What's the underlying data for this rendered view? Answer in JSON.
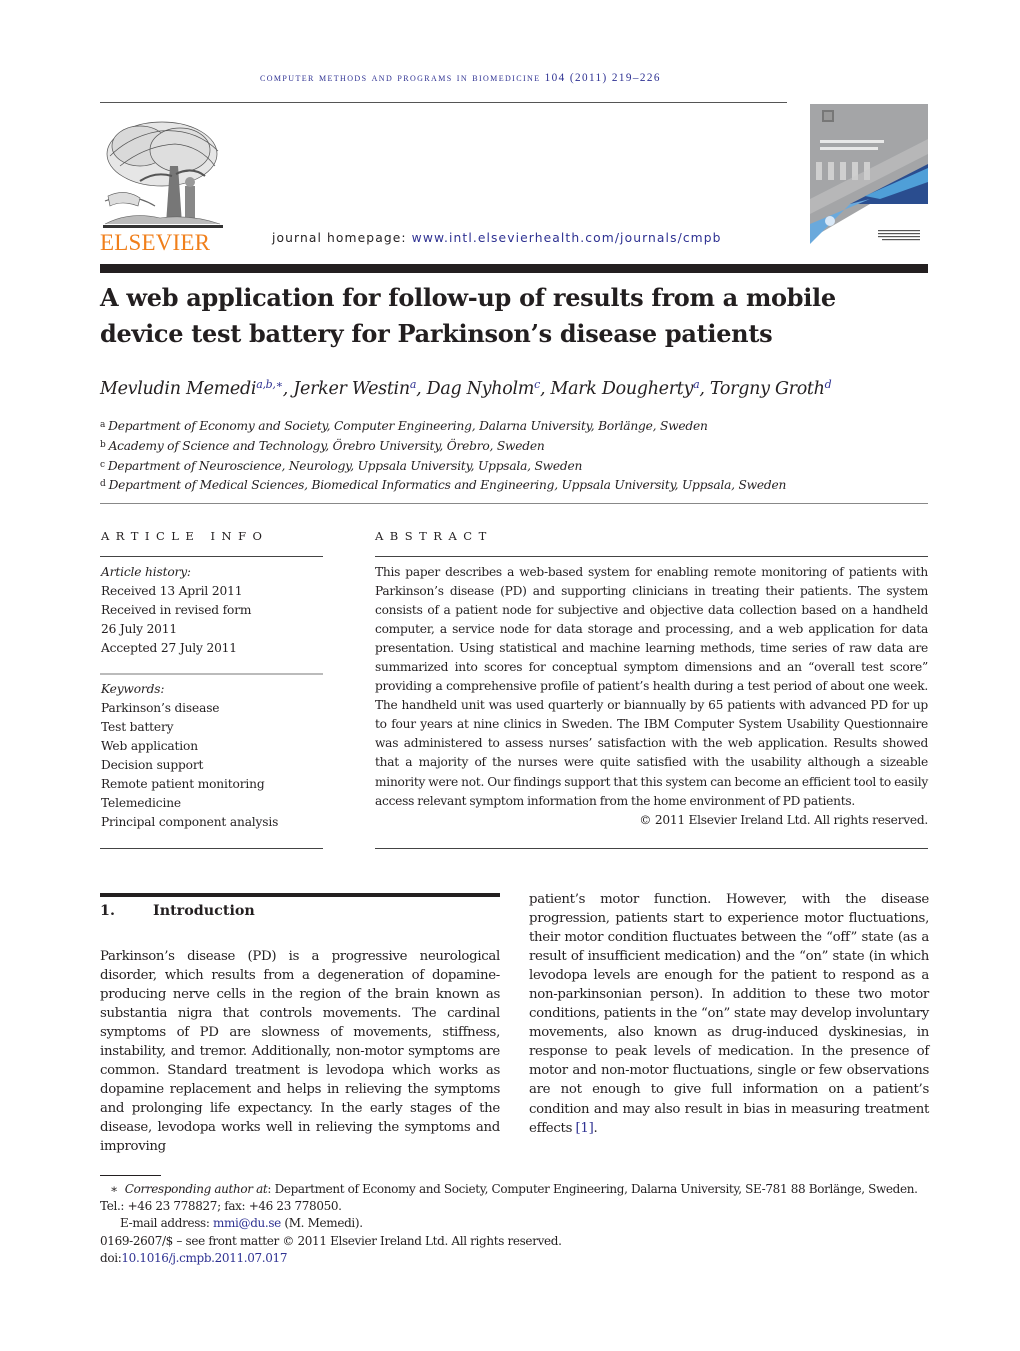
{
  "header": {
    "running_head": "computer methods and programs in biomedicine 104 (2011) 219–226",
    "publisher": "ELSEVIER",
    "homepage_label": "journal homepage: ",
    "homepage_url": "www.intl.elsevierhealth.com/journals/cmpb",
    "cover_title": "Computer Methods and Programs in Biomedicine"
  },
  "article": {
    "title": "A web application for follow-up of results from a mobile device test battery for Parkinson’s disease patients",
    "authors": [
      {
        "name": "Mevludin Memedi",
        "marks": "a,b,∗",
        "sep": ", "
      },
      {
        "name": "Jerker Westin",
        "marks": "a",
        "sep": ", "
      },
      {
        "name": "Dag Nyholm",
        "marks": "c",
        "sep": ", "
      },
      {
        "name": "Mark Dougherty",
        "marks": "a",
        "sep": ", "
      },
      {
        "name": "Torgny Groth",
        "marks": "d",
        "sep": ""
      }
    ],
    "affiliations": [
      {
        "mark": "a",
        "text": "Department of Economy and Society, Computer Engineering, Dalarna University, Borlänge, Sweden"
      },
      {
        "mark": "b",
        "text": "Academy of Science and Technology, Örebro University, Örebro, Sweden"
      },
      {
        "mark": "c",
        "text": "Department of Neuroscience, Neurology, Uppsala University, Uppsala, Sweden"
      },
      {
        "mark": "d",
        "text": "Department of Medical Sciences, Biomedical Informatics and Engineering, Uppsala University, Uppsala, Sweden"
      }
    ]
  },
  "article_info": {
    "label": "article info",
    "history_label": "Article history:",
    "history": [
      "Received 13 April 2011",
      "Received in revised form",
      "26 July 2011",
      "Accepted 27 July 2011"
    ],
    "keywords_label": "Keywords:",
    "keywords": [
      "Parkinson’s disease",
      "Test battery",
      "Web application",
      "Decision support",
      "Remote patient monitoring",
      "Telemedicine",
      "Principal component analysis"
    ]
  },
  "abstract": {
    "label": "abstract",
    "text": "This paper describes a web-based system for enabling remote monitoring of patients with Parkinson’s disease (PD) and supporting clinicians in treating their patients. The system consists of a patient node for subjective and objective data collection based on a handheld computer, a service node for data storage and processing, and a web application for data presentation. Using statistical and machine learning methods, time series of raw data are summarized into scores for conceptual symptom dimensions and an “overall test score” providing a comprehensive profile of patient’s health during a test period of about one week. The handheld unit was used quarterly or biannually by 65 patients with advanced PD for up to four years at nine clinics in Sweden. The IBM Computer System Usability Questionnaire was administered to assess nurses’ satisfaction with the web application. Results showed that a majority of the nurses were quite satisfied with the usability although a sizeable minority were not. Our findings support that this system can become an efficient tool to easily access relevant symptom information from the home environment of PD patients.",
    "copyright": "© 2011 Elsevier Ireland Ltd. All rights reserved."
  },
  "introduction": {
    "number": "1.",
    "heading": "Introduction",
    "left_text": "Parkinson’s disease (PD) is a progressive neurological disorder, which results from a degeneration of dopamine-producing nerve cells in the region of the brain known as substantia nigra that controls movements. The cardinal symptoms of PD are slowness of movements, stiffness, instability, and tremor. Additionally, non-motor symptoms are common. Standard treatment is levodopa which works as dopamine replacement and helps in relieving the symptoms and prolonging life expectancy. In the early stages of the disease, levodopa works well in relieving the symptoms and improving",
    "right_text": "patient’s motor function. However, with the disease progression, patients start to experience motor fluctuations, their motor condition fluctuates between the “off” state (as a result of insufficient medication) and the “on” state (in which levodopa levels are enough for the patient to respond as a non-parkinsonian person). In addition to these two motor conditions, patients in the “on” state may develop involuntary movements, also known as drug-induced dyskinesias, in response to peak levels of medication. In the presence of motor and non-motor fluctuations, single or few observations are not enough to give full information on a patient’s condition and may also result in bias in measuring treatment effects ",
    "ref": "[1]",
    "right_end": "."
  },
  "footnotes": {
    "star": "∗",
    "corr_label": "Corresponding author at",
    "corr_text": ": Department of Economy and Society, Computer Engineering, Dalarna University, SE-781 88 Borlänge, Sweden.",
    "tel": "Tel.: +46 23 778827; fax: +46 23 778050.",
    "email_label": "E-mail address: ",
    "email": "mmi@du.se",
    "email_owner": " (M. Memedi).",
    "front_matter": "0169-2607/$ – see front matter © 2011 Elsevier Ireland Ltd. All rights reserved.",
    "doi_label": "doi:",
    "doi": "10.1016/j.cmpb.2011.07.017"
  }
}
